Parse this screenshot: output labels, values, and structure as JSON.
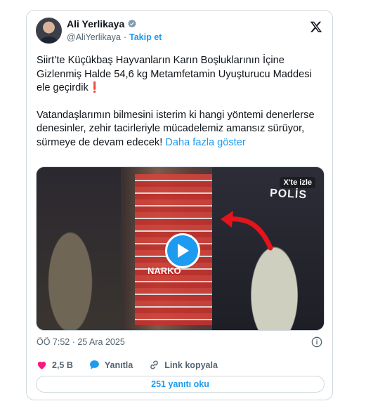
{
  "author": {
    "name": "Ali Yerlikaya",
    "handle": "@AliYerlikaya",
    "separator": "·",
    "follow_label": "Takip et"
  },
  "tweet": {
    "paragraph1": "Siirt’te Küçükbaş Hayvanların Karın Boşluklarının İçine Gizlenmiş Halde 54,6 kg Metamfetamin Uyuşturucu Maddesi ele geçirdik",
    "paragraph1_emoji": "❗",
    "paragraph2": "Vatandaşlarımın bilmesini isterim ki hangi yöntemi denerlerse denesinler, zehir tacirleriyle mücadelemiz amansız sürüyor, sürmeye de devam edecek! ",
    "more_label": "Daha fazla göster"
  },
  "media": {
    "watch_label": "X'te izle",
    "overlay_polis": "POLİS",
    "overlay_brand": "NARKO"
  },
  "meta": {
    "timestamp": "ÖÖ 7:52 · 25 Ara 2025"
  },
  "actions": {
    "likes": "2,5 B",
    "reply_label": "Yanıtla",
    "copy_link_label": "Link kopyala"
  },
  "replies_button": "251 yanıtı oku",
  "colors": {
    "accent": "#1d9bf0",
    "like": "#f91880",
    "text": "#0f1419",
    "muted": "#536471",
    "border": "#cfd9de"
  },
  "icons": [
    "verified-badge-icon",
    "x-logo-icon",
    "play-icon",
    "info-icon",
    "heart-icon",
    "reply-bubble-icon",
    "link-icon",
    "red-arrow-icon"
  ]
}
